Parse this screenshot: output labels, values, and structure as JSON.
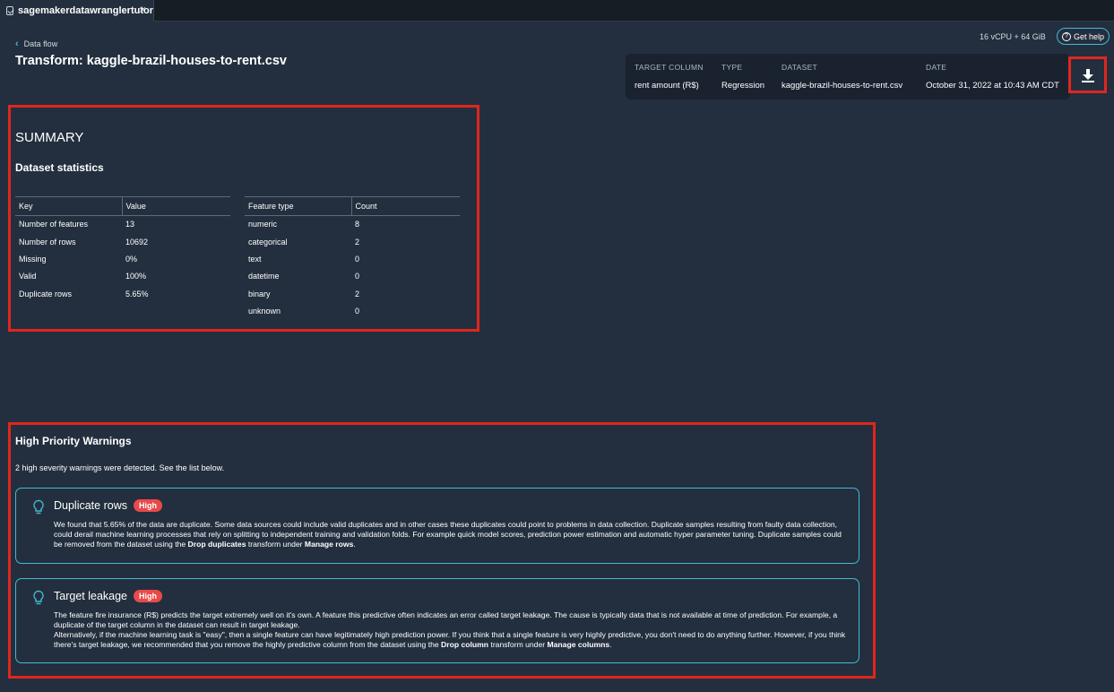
{
  "tab": {
    "title": "sagemakerdatawranglertutor",
    "close": "×"
  },
  "breadcrumb": {
    "label": "Data flow"
  },
  "page_title": "Transform: kaggle-brazil-houses-to-rent.csv",
  "resources": "16 vCPU + 64 GiB",
  "get_help": "Get help",
  "info": {
    "target_column_header": "TARGET COLUMN",
    "target_column_value": "rent amount (R$)",
    "type_header": "TYPE",
    "type_value": "Regression",
    "dataset_header": "DATASET",
    "dataset_value": "kaggle-brazil-houses-to-rent.csv",
    "date_header": "DATE",
    "date_value": "October 31, 2022 at 10:43 AM CDT"
  },
  "summary": {
    "title": "SUMMARY",
    "stats_title": "Dataset statistics",
    "stats_headers": [
      "Key",
      "Value"
    ],
    "stats_rows": [
      [
        "Number of features",
        "13"
      ],
      [
        "Number of rows",
        "10692"
      ],
      [
        "Missing",
        "0%"
      ],
      [
        "Valid",
        "100%"
      ],
      [
        "Duplicate rows",
        "5.65%"
      ]
    ],
    "feature_headers": [
      "Feature type",
      "Count"
    ],
    "feature_rows": [
      [
        "numeric",
        "8"
      ],
      [
        "categorical",
        "2"
      ],
      [
        "text",
        "0"
      ],
      [
        "datetime",
        "0"
      ],
      [
        "binary",
        "2"
      ],
      [
        "unknown",
        "0"
      ]
    ]
  },
  "warnings": {
    "title": "High Priority Warnings",
    "subtitle": "2 high severity warnings were detected. See the list below.",
    "items": [
      {
        "title": "Duplicate rows",
        "badge": "High",
        "body_lines": [
          "We found that 5.65% of the data are duplicate. Some data sources could include valid duplicates and in other cases these duplicates could point to problems in data collection. Duplicate samples resulting from faulty data collection, could derail machine learning processes that rely on splitting to independent training and validation folds. For example quick model scores, prediction power estimation and automatic hyper parameter tuning. Duplicate samples could be removed from the dataset using the ",
          "Drop duplicates",
          " transform under ",
          "Manage rows",
          "."
        ]
      },
      {
        "title": "Target leakage",
        "badge": "High",
        "body_p1": "The feature fire insurance (R$) predicts the target extremely well on it's own. A feature this predictive often indicates an error called target leakage. The cause is typically data that is not available at time of prediction. For example, a duplicate of the target column in the dataset can result in target leakage.",
        "body_lines": [
          "Alternatively, if the machine learning task is \"easy\", then a single feature can have legitimately high prediction power. If you think that a single feature is very highly predictive, you don't need to do anything further. However, if you think there's target leakage, we recommended that you remove the highly predictive column from the dataset using the ",
          "Drop column",
          " transform under ",
          "Manage columns",
          "."
        ]
      }
    ]
  },
  "colors": {
    "background": "#232f3e",
    "accent": "#44b9d6",
    "highlight": "#e0261d",
    "badge": "#e84a4a"
  }
}
